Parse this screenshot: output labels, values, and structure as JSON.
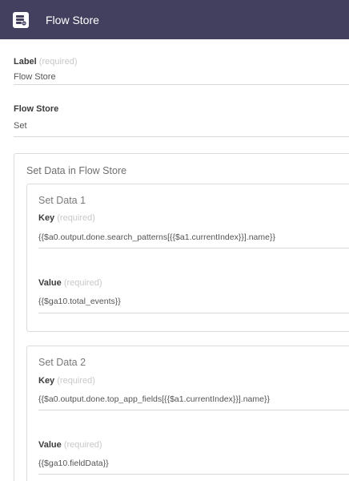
{
  "header": {
    "title": "Flow Store",
    "icon": "flow-store-icon",
    "background": "#43405f"
  },
  "label_field": {
    "label": "Label",
    "required": "(required)",
    "value": "Flow Store"
  },
  "flow_store_field": {
    "label": "Flow Store",
    "value": "Set"
  },
  "set_data_section": {
    "title": "Set Data in Flow Store",
    "items": [
      {
        "title": "Set Data 1",
        "key_label": "Key",
        "key_required": "(required)",
        "key_value": "{{$a0.output.done.search_patterns[{{$a1.currentIndex}}].name}}",
        "value_label": "Value",
        "value_required": "(required)",
        "value_value": "{{$ga10.total_events}}"
      },
      {
        "title": "Set Data 2",
        "key_label": "Key",
        "key_required": "(required)",
        "key_value": "{{$a0.output.done.top_app_fields[{{$a1.currentIndex}}].name}}",
        "value_label": "Value",
        "value_required": "(required)",
        "value_value": "{{$ga10.fieldData}}"
      }
    ]
  }
}
